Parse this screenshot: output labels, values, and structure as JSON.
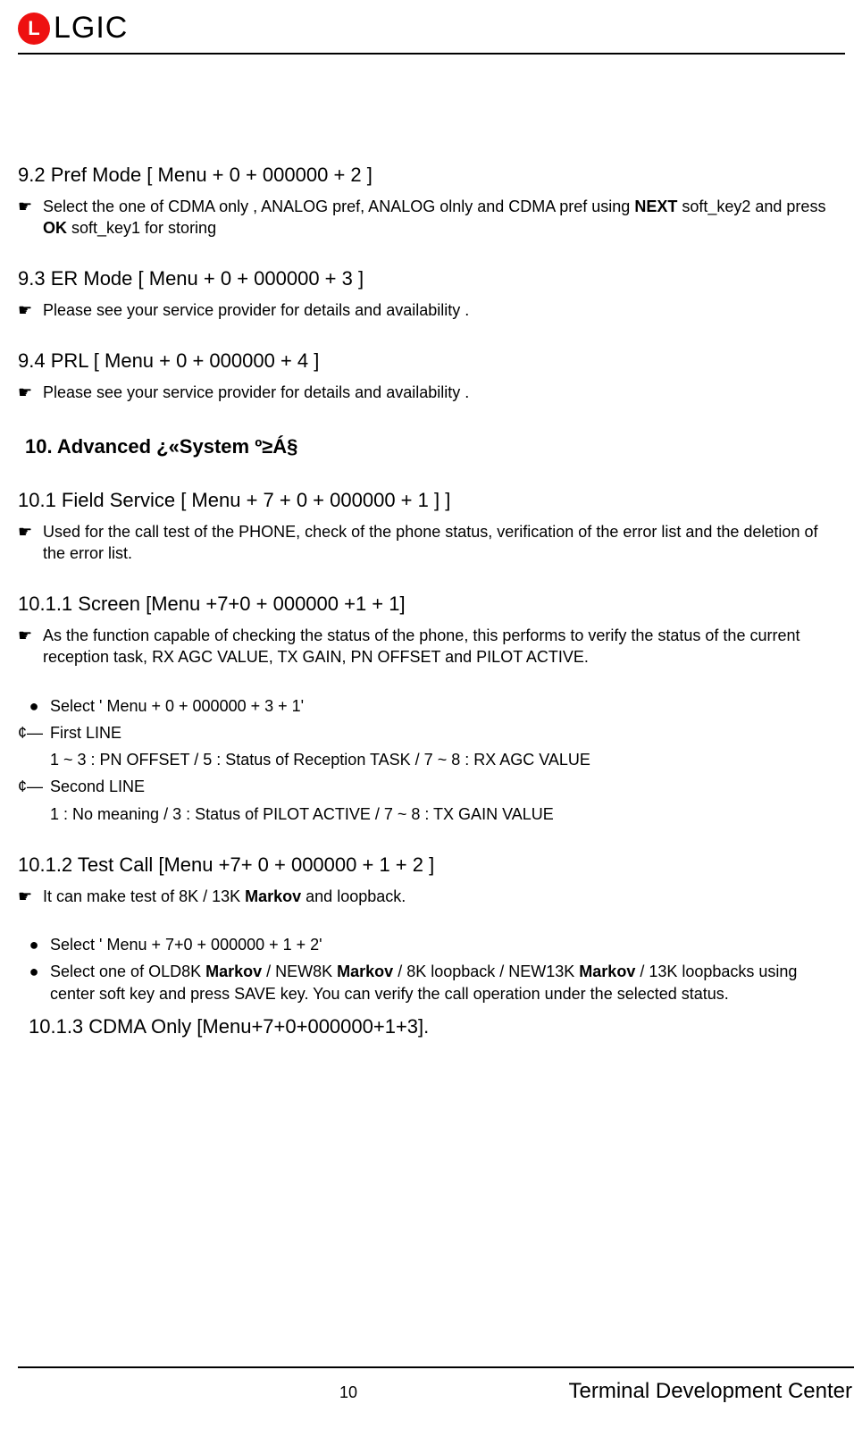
{
  "header": {
    "logo_badge": "L",
    "logo_text": "LGIC"
  },
  "section_9_2": {
    "title": "9.2 Pref Mode [ Menu + 0 + 000000 + 2 ]",
    "p1_pre": "Select the one of CDMA only , ANALOG pref, ANALOG olnly and CDMA pref using ",
    "p1_b1": "NEXT",
    "p1_mid": " soft_key2 and press ",
    "p1_b2": "OK",
    "p1_post": " soft_key1   for storing"
  },
  "section_9_3": {
    "title": "9.3 ER Mode [ Menu + 0 + 000000 + 3 ]",
    "p1": "Please see your service   provider for details and availability ."
  },
  "section_9_4": {
    "title": "9.4 PRL [ Menu + 0 + 000000 + 4 ]",
    "p1": "Please see your service   provider for details and availability ."
  },
  "heading_10": "10.   Advanced ¿«System º≥Á§",
  "section_10_1": {
    "title": "10.1 Field Service [ Menu + 7 + 0 + 000000 + 1 ]   ]",
    "p1": "Used for the call test of the PHONE, check of the phone status, verification of the error list and the deletion of the error list."
  },
  "section_10_1_1": {
    "title": "10.1.1 Screen [Menu +7+0 + 000000 +1 + 1]",
    "p1": "As the function capable of checking the status of the phone, this performs to verify the status of the current reception task, RX AGC VALUE, TX GAIN, PN OFFSET and PILOT ACTIVE.",
    "bullet1": " Select ' Menu + 0 + 000000 + 3 + 1'",
    "line1_label": "First LINE",
    "line1_body": "1 ~ 3 : PN OFFSET / 5 : Status of Reception TASK /   7 ~ 8 :   RX AGC VALUE",
    "line2_label": "Second LINE",
    "line2_body": "1 : No meaning / 3 : Status of PILOT ACTIVE         /   7 ~ 8 :   TX GAIN VALUE"
  },
  "section_10_1_2": {
    "title": "10.1.2 Test Call [Menu +7+ 0 + 000000 + 1 + 2 ]",
    "p1_pre": "It can make test of 8K / 13K ",
    "p1_b1": "Markov",
    "p1_post": " and loopback.",
    "bullet1": " Select ' Menu + 7+0 + 000000 + 1 + 2'",
    "bullet2_pre": " Select one of OLD8K ",
    "bullet2_b1": "Markov",
    "bullet2_mid1": " / NEW8K ",
    "bullet2_b2": "Markov",
    "bullet2_mid2": " / 8K loopback / NEW13K ",
    "bullet2_b3": "Markov",
    "bullet2_post": " / 13K loopbacks using center soft key and press SAVE key. You can verify the call operation under the selected status."
  },
  "section_10_1_3": {
    "title": "10.1.3 CDMA Only [Menu+7+0+000000+1+3]."
  },
  "footer": {
    "page_no": "10",
    "center_text": "Terminal Development Center"
  },
  "marks": {
    "hand": "☛",
    "disc": "●",
    "brace": "¢—"
  }
}
